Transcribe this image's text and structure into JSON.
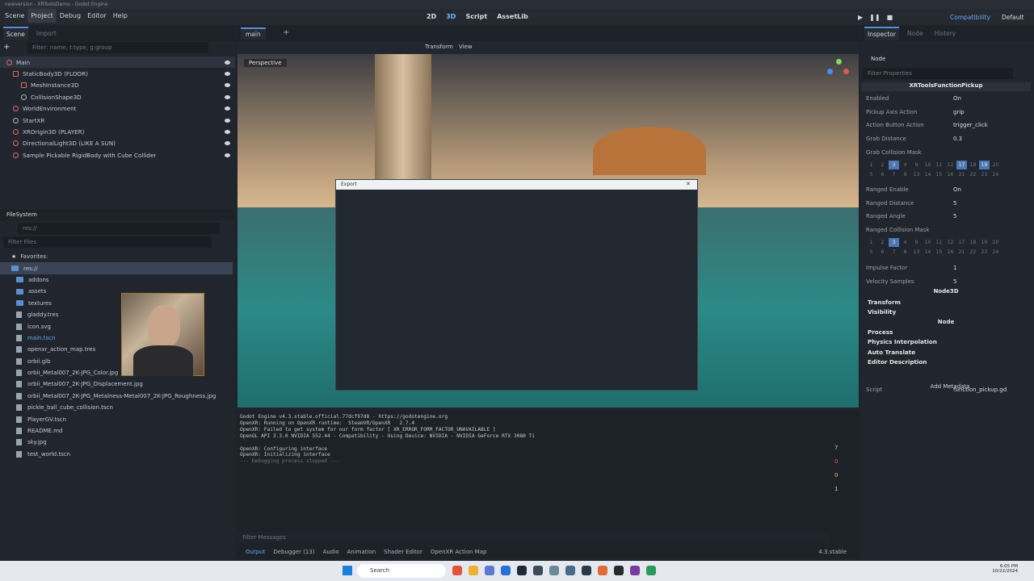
{
  "title_bar": "newversion - XRToolsDemo - Godot Engine",
  "menus": [
    "Scene",
    "Project",
    "Debug",
    "Editor",
    "Help"
  ],
  "workspace": {
    "2d": "2D",
    "3d": "3D",
    "script": "Script",
    "assetlib": "AssetLib"
  },
  "renderer": "Compatibility",
  "layout": "Default",
  "left": {
    "tabs": [
      "Scene",
      "Import"
    ],
    "filter_placeholder": "Filter: name, t:type, g:group",
    "tree": [
      {
        "label": "Main",
        "icon": "node-icon"
      },
      {
        "label": "StaticBody3D (FLOOR)",
        "icon": "body-icon"
      },
      {
        "label": "MeshInstance3D",
        "icon": "mesh-icon"
      },
      {
        "label": "CollisionShape3D",
        "icon": "collision-icon"
      },
      {
        "label": "WorldEnvironment",
        "icon": "world-icon"
      },
      {
        "label": "StartXR",
        "icon": "node-icon"
      },
      {
        "label": "XROrigin3D (PLAYER)",
        "icon": "xr-icon"
      },
      {
        "label": "DirectionalLight3D (LIKE A SUN)",
        "icon": "light-icon"
      },
      {
        "label": "Sample Pickable RigidBody with Cube Collider",
        "icon": "rigid-icon"
      }
    ],
    "fs_tab": "FileSystem",
    "fs_path": "res://",
    "fs_filter": "Filter Files",
    "fs": [
      {
        "label": "Favorites:",
        "type": "fav"
      },
      {
        "label": "res://",
        "type": "folder",
        "sel": true
      },
      {
        "label": "addons",
        "type": "folder"
      },
      {
        "label": "assets",
        "type": "folder"
      },
      {
        "label": "textures",
        "type": "folder"
      },
      {
        "label": "gladdy.tres",
        "type": "file"
      },
      {
        "label": "icon.svg",
        "type": "file"
      },
      {
        "label": "main.tscn",
        "type": "file"
      },
      {
        "label": "openxr_action_map.tres",
        "type": "file"
      },
      {
        "label": "orbii.glb",
        "type": "file"
      },
      {
        "label": "orbii_Metal007_2K-JPG_Color.jpg",
        "type": "file"
      },
      {
        "label": "orbii_Metal007_2K-JPG_Displacement.jpg",
        "type": "file"
      },
      {
        "label": "orbii_Metal007_2K-JPG_Metalness-Metal007_2K-JPG_Roughness.jpg",
        "type": "file"
      },
      {
        "label": "pickle_ball_cube_collision.tscn",
        "type": "file"
      },
      {
        "label": "PlayerGV.tscn",
        "type": "file"
      },
      {
        "label": "README.md",
        "type": "file"
      },
      {
        "label": "sky.jpg",
        "type": "file"
      },
      {
        "label": "test_world.tscn",
        "type": "file"
      }
    ]
  },
  "viewport": {
    "tab": "main",
    "transform": "Transform",
    "view": "View",
    "perspective": "Perspective"
  },
  "dialog": {
    "title": "Export"
  },
  "output": {
    "lines": [
      "Godot Engine v4.3.stable.official.77dcf97d8 - https://godotengine.org",
      "OpenXR: Running on OpenXR runtime:  SteamVR/OpenXR   2.7.4",
      "OpenXR: Failed to get system for our form factor [ XR_ERROR_FORM_FACTOR_UNAVAILABLE ]",
      "OpenGL API 3.3.0 NVIDIA 552.44 - Compatibility - Using Device: NVIDIA - NVIDIA GeForce RTX 3080 Ti",
      "",
      "OpenXR: Configuring interface",
      "OpenXR: Initializing interface"
    ],
    "stopped": "--- Debugging process stopped ---",
    "filter": "Filter Messages",
    "counts": [
      "7",
      "0",
      "0",
      "1"
    ]
  },
  "bottom_tabs": [
    "Output",
    "Debugger (13)",
    "Audio",
    "Animation",
    "Shader Editor",
    "OpenXR Action Map"
  ],
  "version": "4.3.stable",
  "inspector": {
    "tabs": [
      "Inspector",
      "Node",
      "History"
    ],
    "node": "Node",
    "filter": "Filter Properties",
    "script_title": "XRToolsFunctionPickup",
    "props1": [
      [
        "Enabled",
        "On"
      ],
      [
        "Pickup Axis Action",
        "grip"
      ],
      [
        "Action Button Action",
        "trigger_click"
      ],
      [
        "Grab Distance",
        "0.3"
      ],
      [
        "Grab Collision Mask",
        ""
      ]
    ],
    "props2": [
      [
        "Ranged Enable",
        "On"
      ],
      [
        "Ranged Distance",
        "5"
      ],
      [
        "Ranged Angle",
        "5"
      ],
      [
        "Ranged Collision Mask",
        ""
      ]
    ],
    "props3": [
      [
        "Impulse Factor",
        "1"
      ],
      [
        "Velocity Samples",
        "5"
      ]
    ],
    "node3d": "Node3D",
    "sections1": [
      "Transform",
      "Visibility"
    ],
    "sections2": [
      "Process",
      "Physics Interpolation",
      "Auto Translate",
      "Editor Description"
    ],
    "script_label": "Script",
    "script_value": "function_pickup.gd",
    "add_meta": "Add Metadata"
  },
  "mask_on_1": [
    3,
    17,
    19
  ],
  "mask_on_2": [
    3
  ],
  "taskbar": {
    "search": "Search",
    "time": "6:05 PM",
    "date": "10/22/2024"
  }
}
